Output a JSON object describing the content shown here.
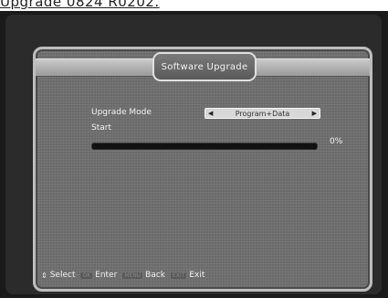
{
  "caption": "Upgrade 0824 R0202.",
  "osd": {
    "title": "Software Upgrade",
    "upgrade_mode_label": "Upgrade Mode",
    "upgrade_mode_value": "Program+Data",
    "start_label": "Start",
    "progress_text": "0%",
    "progress_fraction": 0
  },
  "help": {
    "select_icon": "updown-arrow-icon",
    "select_label": "Select",
    "enter_key": "OK",
    "enter_label": "Enter",
    "back_key": "MENU",
    "back_label": "Back",
    "exit_key": "EXIT",
    "exit_label": "Exit"
  }
}
